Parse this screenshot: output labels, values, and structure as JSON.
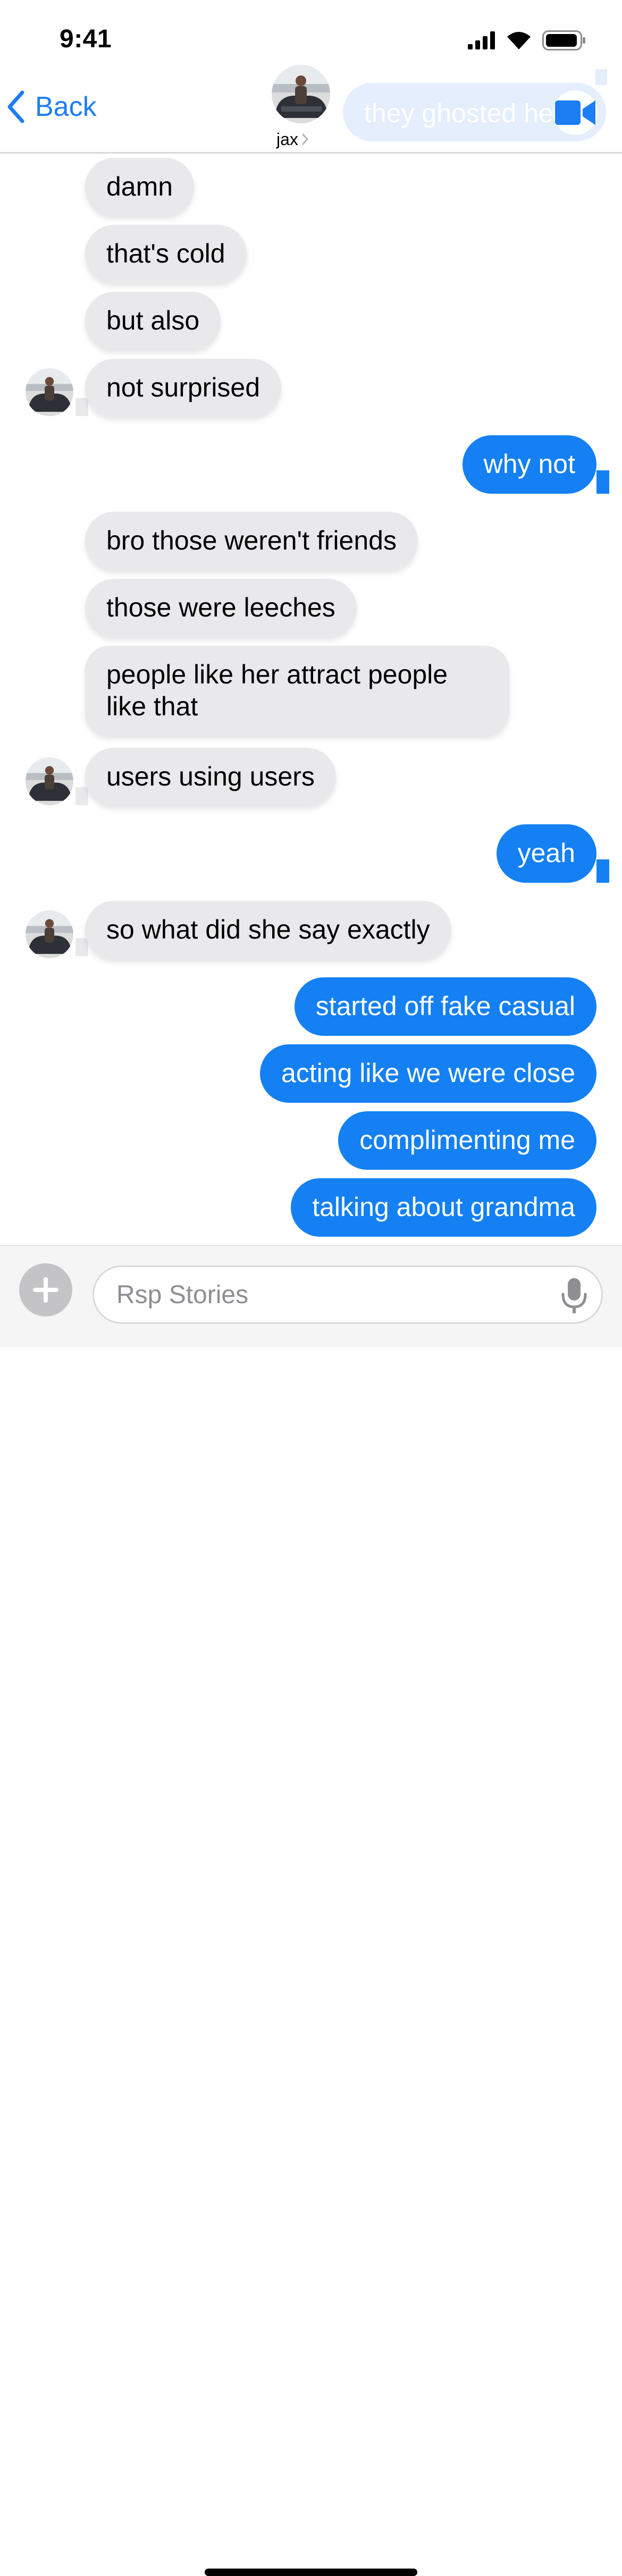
{
  "status_bar": {
    "time": "9:41",
    "icons": [
      "cellular-signal-icon",
      "wifi-icon",
      "battery-icon"
    ]
  },
  "header": {
    "back_label": "Back",
    "contact_name": "jax",
    "overlay_message": "they ghosted her",
    "icons": [
      "chevron-left-icon",
      "chevron-right-icon",
      "video-camera-icon"
    ]
  },
  "messages": [
    {
      "sender": "them",
      "text": "damn"
    },
    {
      "sender": "them",
      "text": "that's cold"
    },
    {
      "sender": "them",
      "text": "but also"
    },
    {
      "sender": "them",
      "text": "not surprised"
    },
    {
      "sender": "me",
      "text": "why not"
    },
    {
      "sender": "them",
      "text": "bro those weren't friends"
    },
    {
      "sender": "them",
      "text": "those were leeches"
    },
    {
      "sender": "them",
      "text": "people like her attract people like that"
    },
    {
      "sender": "them",
      "text": "users using users"
    },
    {
      "sender": "me",
      "text": "yeah"
    },
    {
      "sender": "them",
      "text": "so what did she say exactly"
    },
    {
      "sender": "me",
      "text": "started off fake casual"
    },
    {
      "sender": "me",
      "text": "acting like we were close"
    },
    {
      "sender": "me",
      "text": "complimenting me"
    },
    {
      "sender": "me",
      "text": "talking about grandma"
    }
  ],
  "composer": {
    "placeholder": "Rsp Stories",
    "icons": [
      "plus-icon",
      "microphone-icon"
    ]
  },
  "colors": {
    "accent": "#1d7ef4",
    "outgoing_bubble": "#1480f3",
    "incoming_bubble": "#e9e9eb",
    "overlay_bubble": "#e4eefc"
  }
}
